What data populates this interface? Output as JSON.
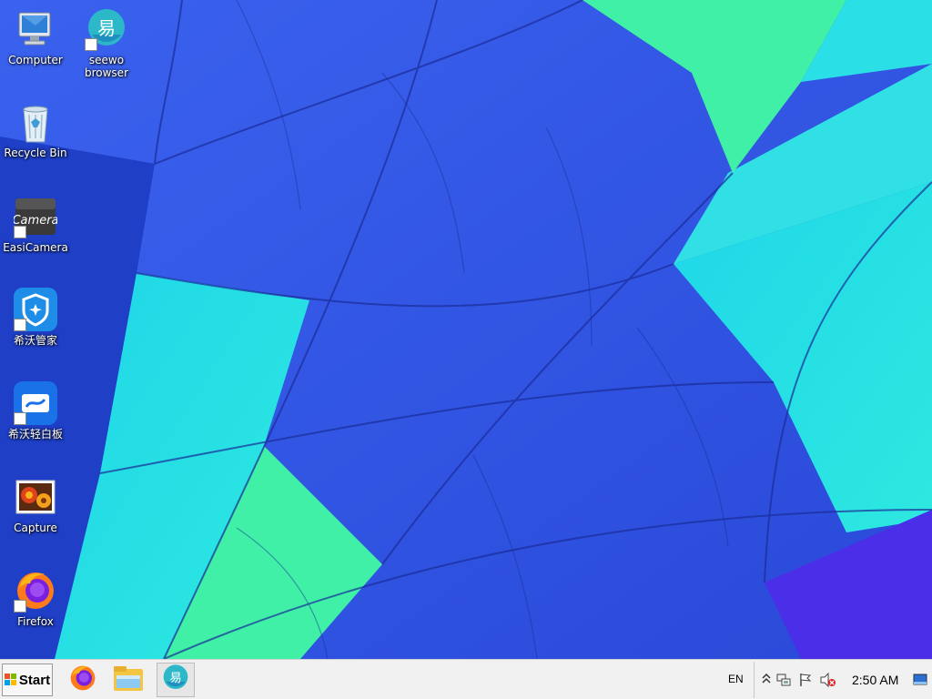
{
  "desktop": {
    "icons": [
      {
        "label": "Computer",
        "icon": "computer-icon"
      },
      {
        "label": "seewo\nbrowser",
        "icon": "seewo-browser-icon"
      },
      {
        "label": "Recycle Bin",
        "icon": "recycle-bin-icon"
      },
      {
        "label": "EasiCamera",
        "icon": "easicamera-icon"
      },
      {
        "label": "希沃管家",
        "icon": "seewo-manager-icon"
      },
      {
        "label": "希沃轻白板",
        "icon": "seewo-whiteboard-icon"
      },
      {
        "label": "Capture",
        "icon": "capture-icon"
      },
      {
        "label": "Firefox",
        "icon": "firefox-icon"
      }
    ],
    "camera_icon_text": "Camera",
    "seewo_glyph": "易"
  },
  "taskbar": {
    "start_label": "Start",
    "pinned": [
      {
        "icon": "firefox-icon"
      },
      {
        "icon": "file-explorer-icon"
      },
      {
        "icon": "seewo-browser-icon",
        "active": true
      }
    ],
    "language": "EN",
    "tray_icons": [
      "show-hidden-icons-icon",
      "network-icon",
      "action-center-flag-icon",
      "volume-muted-icon"
    ],
    "clock": "2:50 AM"
  },
  "colors": {
    "wallpaper_blue": "#2f56e6",
    "wallpaper_cyan": "#25e6e6",
    "wallpaper_green": "#3ff0a6",
    "wallpaper_violet": "#4a2ee8",
    "taskbar_bg": "#f1f1f1"
  }
}
